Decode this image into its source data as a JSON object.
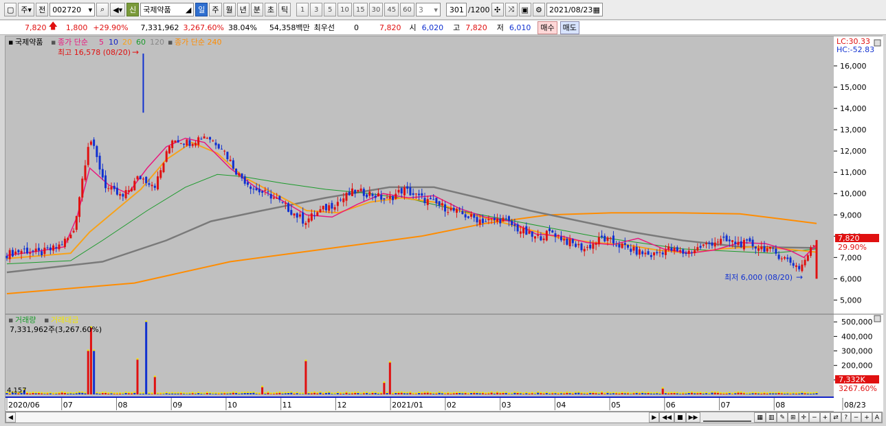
{
  "toolbar": {
    "market_type": "주",
    "jeon": "전",
    "stock_code": "002720",
    "shin_badge": "신",
    "stock_name": "국제약품",
    "periods": [
      "일",
      "주",
      "월",
      "년",
      "분",
      "초",
      "틱"
    ],
    "active_period": "일",
    "minute_intervals": [
      "1",
      "3",
      "5",
      "10",
      "15",
      "30",
      "45",
      "60"
    ],
    "interval_value": "3",
    "count_value": "301",
    "count_max": "/1200",
    "date_value": "2021/08/23"
  },
  "quote": {
    "price": "7,820",
    "change": "1,800",
    "change_pct": "+29.90%",
    "volume": "7,331,962",
    "volume_ratio": "3,267.60%",
    "turnover": "38.04%",
    "amount": "54,358백만",
    "pref_label": "최우선",
    "pref_value": "0",
    "pref_price": "7,820",
    "open_label": "시",
    "open_value": "6,020",
    "high_label": "고",
    "high_value": "7,820",
    "low_label": "저",
    "low_value": "6,010",
    "buy_label": "매수",
    "sell_label": "매도"
  },
  "legend": {
    "name": "국제약품",
    "ma_label": "종가 단순",
    "ma_periods": [
      "5",
      "10",
      "20",
      "60",
      "120"
    ],
    "ma240_label": "종가 단순 240",
    "ma_colors": [
      "#e8187e",
      "#1020c8",
      "#f7a21a",
      "#1a9a2a",
      "#7a7a7a"
    ],
    "ma240_color": "#ff8c00"
  },
  "annotations": {
    "high_note": "최고 16,578 (08/20)",
    "low_note": "최저 6,000 (08/20)",
    "lc": "LC:30.33",
    "hc": "HC:-52.83",
    "price_tag": "7,820",
    "pct_tag": "29.90%"
  },
  "volume_panel": {
    "label1": "거래량",
    "label2": "거래대금",
    "value_text": "7,331,962주(3,267.60%)",
    "small_left": "4,157",
    "vol_tag": "7,332K",
    "vol_pct_tag": "3267.60%"
  },
  "colors": {
    "up": "#e01010",
    "down": "#1030d0",
    "background": "#c0c0c0"
  },
  "chart_data": [
    {
      "type": "candlestick",
      "title": "국제약품",
      "y_axis_ticks": [
        5000,
        6000,
        7000,
        8000,
        9000,
        10000,
        11000,
        12000,
        13000,
        14000,
        15000,
        16000
      ],
      "ylim": [
        4400,
        17000
      ],
      "x_tick_labels": [
        "2020/06",
        "07",
        "08",
        "09",
        "10",
        "11",
        "12",
        "2021/01",
        "02",
        "03",
        "04",
        "05",
        "06",
        "07",
        "08",
        "08/23"
      ],
      "close_path": [
        [
          "2020/06",
          7150
        ],
        [
          "2020/06",
          7350
        ],
        [
          "07",
          7200
        ],
        [
          "07",
          7450
        ],
        [
          "07",
          8100
        ],
        [
          "07",
          12700
        ],
        [
          "07",
          10300
        ],
        [
          "07",
          9800
        ],
        [
          "08",
          10800
        ],
        [
          "08",
          10400
        ],
        [
          "08",
          12600
        ],
        [
          "08",
          12400
        ],
        [
          "09",
          12750
        ],
        [
          "09",
          12200
        ],
        [
          "09",
          10900
        ],
        [
          "09",
          10200
        ],
        [
          "10",
          9900
        ],
        [
          "10",
          9300
        ],
        [
          "10",
          8700
        ],
        [
          "11",
          9200
        ],
        [
          "11",
          9600
        ],
        [
          "11",
          10100
        ],
        [
          "12",
          10000
        ],
        [
          "12",
          9700
        ],
        [
          "12",
          10200
        ],
        [
          "2021/01",
          9800
        ],
        [
          "2021/01",
          9500
        ],
        [
          "2021/01",
          9200
        ],
        [
          "02",
          8900
        ],
        [
          "02",
          8700
        ],
        [
          "02",
          8800
        ],
        [
          "03",
          8300
        ],
        [
          "03",
          7900
        ],
        [
          "03",
          8200
        ],
        [
          "04",
          7700
        ],
        [
          "04",
          7400
        ],
        [
          "04",
          7900
        ],
        [
          "05",
          7600
        ],
        [
          "05",
          7300
        ],
        [
          "05",
          7100
        ],
        [
          "06",
          7400
        ],
        [
          "06",
          7200
        ],
        [
          "06",
          7500
        ],
        [
          "07",
          7800
        ],
        [
          "07",
          7700
        ],
        [
          "07",
          7600
        ],
        [
          "08",
          7400
        ],
        [
          "08",
          7000
        ],
        [
          "08",
          6500
        ],
        [
          "08/23",
          7820
        ]
      ],
      "extremes": {
        "high": 16578,
        "low": 6000
      },
      "moving_averages": {
        "ma5": [
          [
            0,
            7100
          ],
          [
            10,
            7300
          ],
          [
            18,
            7500
          ],
          [
            22,
            8900
          ],
          [
            26,
            11200
          ],
          [
            32,
            10400
          ],
          [
            38,
            10000
          ],
          [
            44,
            11200
          ],
          [
            50,
            12200
          ],
          [
            56,
            12600
          ],
          [
            62,
            12400
          ],
          [
            70,
            11200
          ],
          [
            78,
            10300
          ],
          [
            86,
            9700
          ],
          [
            94,
            9000
          ],
          [
            102,
            8900
          ],
          [
            110,
            9500
          ],
          [
            118,
            10000
          ],
          [
            126,
            9800
          ],
          [
            134,
            9900
          ],
          [
            142,
            9300
          ],
          [
            150,
            8900
          ],
          [
            158,
            8700
          ],
          [
            166,
            8100
          ],
          [
            174,
            8000
          ],
          [
            182,
            7700
          ],
          [
            190,
            7600
          ],
          [
            198,
            7900
          ],
          [
            206,
            7400
          ],
          [
            214,
            7200
          ],
          [
            222,
            7350
          ],
          [
            230,
            7700
          ],
          [
            238,
            7650
          ],
          [
            246,
            7300
          ],
          [
            250,
            7000
          ],
          [
            254,
            7600
          ]
        ],
        "ma20": [
          [
            0,
            6950
          ],
          [
            20,
            7200
          ],
          [
            26,
            8200
          ],
          [
            34,
            9200
          ],
          [
            42,
            10200
          ],
          [
            50,
            11600
          ],
          [
            58,
            12400
          ],
          [
            66,
            11900
          ],
          [
            74,
            10800
          ],
          [
            84,
            10000
          ],
          [
            94,
            9200
          ],
          [
            104,
            9100
          ],
          [
            114,
            9600
          ],
          [
            124,
            9800
          ],
          [
            134,
            9600
          ],
          [
            144,
            9100
          ],
          [
            154,
            8700
          ],
          [
            164,
            8300
          ],
          [
            174,
            7900
          ],
          [
            184,
            7700
          ],
          [
            194,
            7600
          ],
          [
            204,
            7350
          ],
          [
            214,
            7200
          ],
          [
            224,
            7400
          ],
          [
            234,
            7500
          ],
          [
            244,
            7400
          ],
          [
            254,
            7250
          ]
        ],
        "ma60": [
          [
            0,
            6700
          ],
          [
            20,
            6850
          ],
          [
            30,
            7800
          ],
          [
            44,
            9200
          ],
          [
            56,
            10300
          ],
          [
            66,
            10900
          ],
          [
            74,
            10800
          ],
          [
            86,
            10500
          ],
          [
            100,
            10200
          ],
          [
            114,
            10000
          ],
          [
            128,
            9700
          ],
          [
            142,
            9200
          ],
          [
            156,
            8800
          ],
          [
            170,
            8400
          ],
          [
            184,
            8000
          ],
          [
            198,
            7700
          ],
          [
            212,
            7400
          ],
          [
            226,
            7300
          ],
          [
            240,
            7200
          ],
          [
            254,
            7400
          ]
        ],
        "ma120": [
          [
            0,
            6300
          ],
          [
            30,
            6800
          ],
          [
            50,
            7800
          ],
          [
            64,
            8700
          ],
          [
            80,
            9200
          ],
          [
            100,
            9800
          ],
          [
            120,
            10300
          ],
          [
            134,
            10300
          ],
          [
            148,
            9800
          ],
          [
            164,
            9200
          ],
          [
            180,
            8700
          ],
          [
            196,
            8200
          ],
          [
            212,
            7800
          ],
          [
            230,
            7500
          ],
          [
            254,
            7450
          ]
        ],
        "ma240": [
          [
            0,
            5300
          ],
          [
            40,
            5800
          ],
          [
            70,
            6800
          ],
          [
            100,
            7400
          ],
          [
            130,
            8000
          ],
          [
            150,
            8600
          ],
          [
            170,
            9000
          ],
          [
            190,
            9100
          ],
          [
            210,
            9100
          ],
          [
            230,
            9050
          ],
          [
            254,
            8600
          ]
        ]
      }
    },
    {
      "type": "bar",
      "title": "거래량",
      "y_axis_ticks": [
        100000,
        200000,
        300000,
        400000,
        500000
      ],
      "y_tick_labels": [
        "100,000",
        "200,000",
        "300,000",
        "400,000",
        "500,000"
      ],
      "ylim": [
        0,
        520000
      ],
      "spikes": [
        [
          6,
          30000
        ],
        [
          28,
          300000
        ],
        [
          29,
          460000
        ],
        [
          30,
          300000
        ],
        [
          45,
          240000
        ],
        [
          48,
          500000
        ],
        [
          51,
          120000
        ],
        [
          88,
          50000
        ],
        [
          103,
          230000
        ],
        [
          132,
          220000
        ],
        [
          130,
          80000
        ],
        [
          226,
          40000
        ],
        [
          283,
          80000
        ],
        [
          286,
          120000
        ]
      ]
    }
  ]
}
